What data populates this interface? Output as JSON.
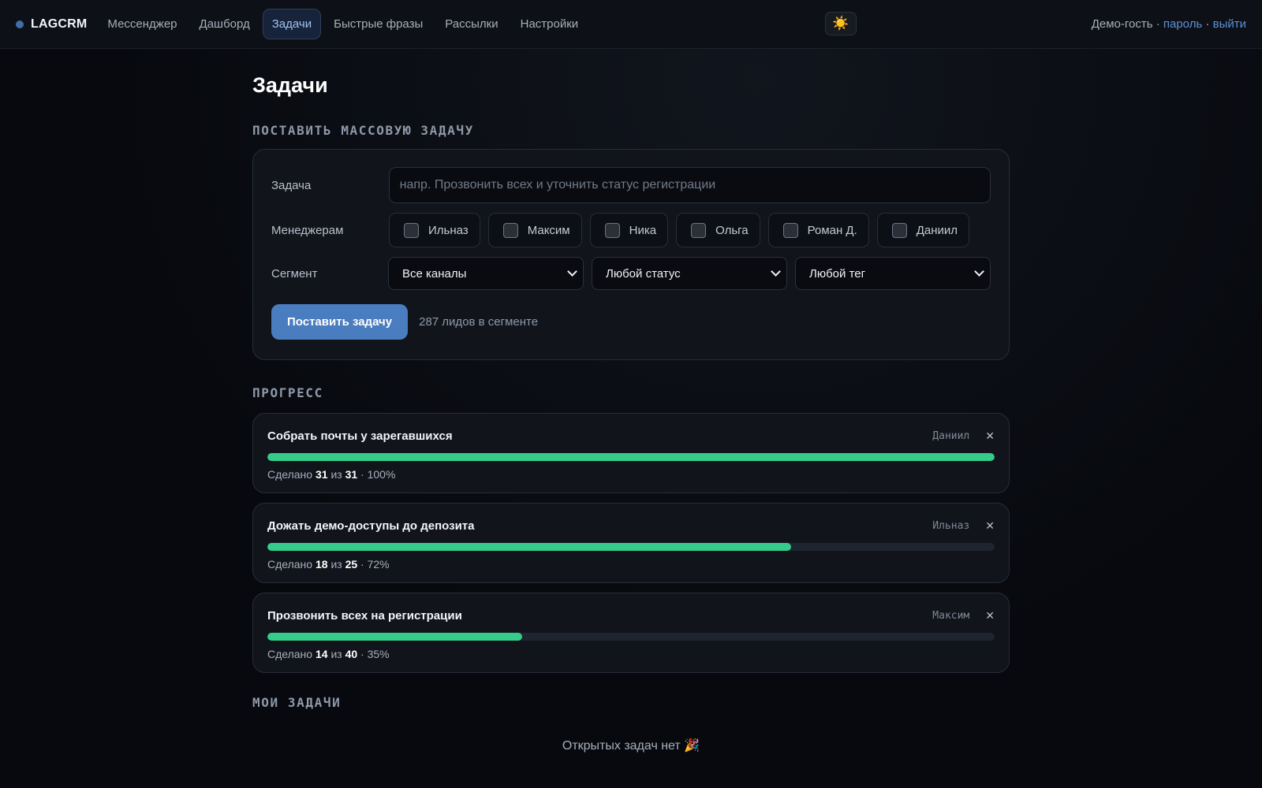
{
  "brand": "LAGCRM",
  "nav": [
    {
      "label": "Мессенджер",
      "active": false
    },
    {
      "label": "Дашборд",
      "active": false
    },
    {
      "label": "Задачи",
      "active": true
    },
    {
      "label": "Быстрые фразы",
      "active": false
    },
    {
      "label": "Рассылки",
      "active": false
    },
    {
      "label": "Настройки",
      "active": false
    }
  ],
  "theme_icon": "☀️",
  "user": {
    "name": "Демо-гость",
    "sep": " · ",
    "password_link": "пароль",
    "logout_link": "выйти"
  },
  "page_title": "Задачи",
  "mass_task": {
    "section_title": "ПОСТАВИТЬ МАССОВУЮ ЗАДАЧУ",
    "task_label": "Задача",
    "task_placeholder": "напр. Прозвонить всех и уточнить статус регистрации",
    "task_value": "",
    "managers_label": "Менеджерам",
    "managers": [
      "Ильназ",
      "Максим",
      "Ника",
      "Ольга",
      "Роман Д.",
      "Даниил"
    ],
    "segment_label": "Сегмент",
    "segment_selects": [
      "Все каналы",
      "Любой статус",
      "Любой тег"
    ],
    "submit_label": "Поставить задачу",
    "segment_count": "287 лидов в сегменте"
  },
  "progress": {
    "section_title": "ПРОГРЕСС",
    "done_prefix": "Сделано",
    "of_word": "из",
    "items": [
      {
        "title": "Собрать почты у зарегавшихся",
        "assignee": "Даниил",
        "done": "31",
        "total": "31",
        "percent": "100%",
        "fraction": 1.0
      },
      {
        "title": "Дожать демо-доступы до депозита",
        "assignee": "Ильназ",
        "done": "18",
        "total": "25",
        "percent": "72%",
        "fraction": 0.72
      },
      {
        "title": "Прозвонить всех на регистрации",
        "assignee": "Максим",
        "done": "14",
        "total": "40",
        "percent": "35%",
        "fraction": 0.35
      }
    ]
  },
  "my_tasks": {
    "section_title": "МОИ ЗАДАЧИ",
    "empty_text": "Открытых задач нет 🎉"
  },
  "colors": {
    "accent": "#4a7cc0",
    "progress": "#35cc8b",
    "link": "#5b93d6"
  }
}
